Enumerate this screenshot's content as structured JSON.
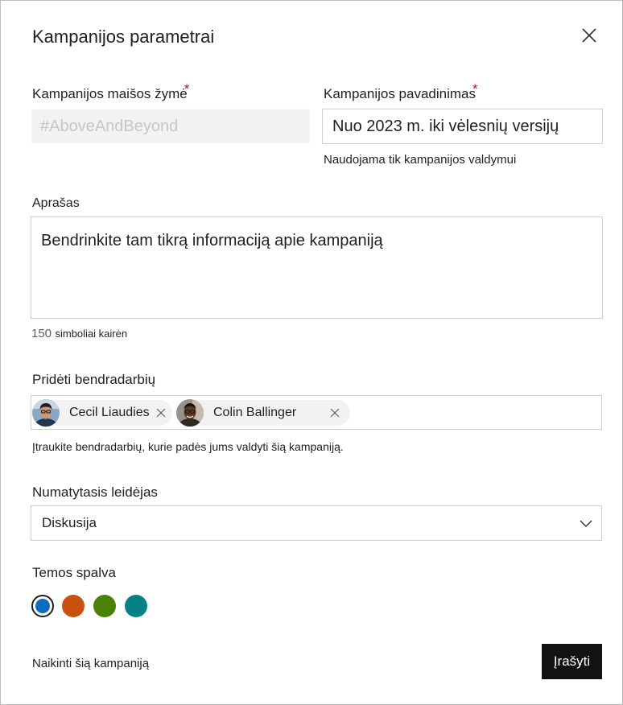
{
  "dialog": {
    "title": "Kampanijos parametrai"
  },
  "hashtag": {
    "label": "Kampanijos maišos žymė",
    "required_mark": "*",
    "placeholder": "#AboveAndBeyond"
  },
  "campaign_name": {
    "label": "Kampanijos pavadinimas",
    "required_mark": "*",
    "value": "Nuo 2023 m. iki vėlesnių versijų",
    "helper": "Naudojama tik kampanijos valdymui"
  },
  "description": {
    "label": "Aprašas",
    "value": "Bendrinkite tam tikrą informaciją apie kampaniją",
    "count": "150",
    "count_text": "simboliai kairėn"
  },
  "collaborators": {
    "label": "Pridėti bendradarbių",
    "people": [
      {
        "name": "Cecil  Liaudies"
      },
      {
        "name": "Colin Ballinger"
      }
    ],
    "helper": "Įtraukite bendradarbių, kurie padės jums valdyti šią kampaniją."
  },
  "publisher": {
    "label": "Numatytasis leidėjas",
    "selected": "Diskusija"
  },
  "theme": {
    "label": "Temos spalva",
    "colors": [
      "#0f6cbd",
      "#ca5010",
      "#498205",
      "#038387"
    ],
    "selected_index": 0
  },
  "footer": {
    "delete_label": "Naikinti šią kampaniją",
    "save_label": "Įrašyti"
  }
}
